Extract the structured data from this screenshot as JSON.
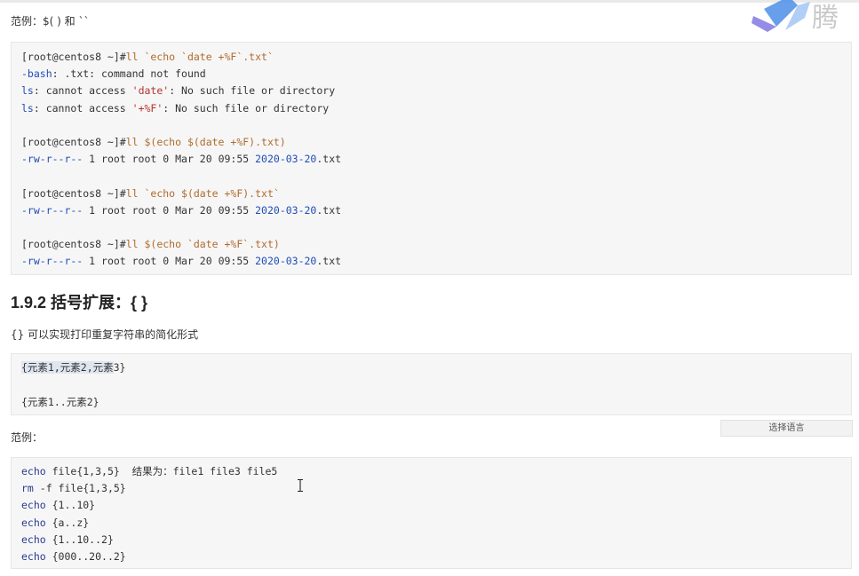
{
  "intro_label": "范例：$( ) 和 ``",
  "code_block_1": {
    "groups": [
      [
        [
          {
            "t": "[root@centos8 ~]#",
            "c": "prompt"
          },
          {
            "t": "ll `echo `date +%F`.txt`",
            "c": "cmd"
          }
        ],
        [
          {
            "t": "-bash",
            "c": "blue"
          },
          {
            "t": ": .txt: command not found",
            "c": ""
          }
        ],
        [
          {
            "t": "ls",
            "c": "blue"
          },
          {
            "t": ": cannot access ",
            "c": ""
          },
          {
            "t": "'date'",
            "c": "red"
          },
          {
            "t": ": No such file or directory",
            "c": ""
          }
        ],
        [
          {
            "t": "ls",
            "c": "blue"
          },
          {
            "t": ": cannot access ",
            "c": ""
          },
          {
            "t": "'+%F'",
            "c": "red"
          },
          {
            "t": ": No such file or directory",
            "c": ""
          }
        ]
      ],
      [
        [
          {
            "t": "[root@centos8 ~]#",
            "c": "prompt"
          },
          {
            "t": "ll $(echo $(date +%F).txt)",
            "c": "cmd"
          }
        ],
        [
          {
            "t": "-rw-r--r--",
            "c": "blue"
          },
          {
            "t": " 1 root root 0 Mar 20 09:55 ",
            "c": ""
          },
          {
            "t": "2020-03-20",
            "c": "blue"
          },
          {
            "t": ".txt",
            "c": ""
          }
        ]
      ],
      [
        [
          {
            "t": "[root@centos8 ~]#",
            "c": "prompt"
          },
          {
            "t": "ll `echo $(date +%F).txt`",
            "c": "cmd"
          }
        ],
        [
          {
            "t": "-rw-r--r--",
            "c": "blue"
          },
          {
            "t": " 1 root root 0 Mar 20 09:55 ",
            "c": ""
          },
          {
            "t": "2020-03-20",
            "c": "blue"
          },
          {
            "t": ".txt",
            "c": ""
          }
        ]
      ],
      [
        [
          {
            "t": "[root@centos8 ~]#",
            "c": "prompt"
          },
          {
            "t": "ll $(echo `date +%F`.txt)",
            "c": "cmd"
          }
        ],
        [
          {
            "t": "-rw-r--r--",
            "c": "blue"
          },
          {
            "t": " 1 root root 0 Mar 20 09:55 ",
            "c": ""
          },
          {
            "t": "2020-03-20",
            "c": "blue"
          },
          {
            "t": ".txt",
            "c": ""
          }
        ]
      ]
    ]
  },
  "section_heading": "1.9.2 括号扩展：{ }",
  "section_desc": "{} 可以实现打印重复字符串的简化形式",
  "syntax_block": {
    "line1_hl": "{元素1,元素2,元素",
    "line1_rest": "3}",
    "line2": "{元素1..元素2}"
  },
  "example_label": "范例：",
  "select_language": "选择语言",
  "code_block_2": {
    "lines": [
      [
        {
          "t": "echo",
          "c": "kw"
        },
        {
          "t": " file{1,3,5}  结果为：file1 file3 file5",
          "c": ""
        }
      ],
      [
        {
          "t": "rm",
          "c": "kw"
        },
        {
          "t": " -f file{1,3,5}",
          "c": ""
        }
      ],
      [
        {
          "t": "echo",
          "c": "kw"
        },
        {
          "t": " {1..10}",
          "c": ""
        }
      ],
      [
        {
          "t": "echo",
          "c": "kw"
        },
        {
          "t": " {a..z}",
          "c": ""
        }
      ],
      [
        {
          "t": "echo",
          "c": "kw"
        },
        {
          "t": " {1..10..2}",
          "c": ""
        }
      ],
      [
        {
          "t": "echo",
          "c": "kw"
        },
        {
          "t": " {000..20..2}",
          "c": ""
        }
      ]
    ]
  },
  "logo_text": "腾",
  "colors": {
    "prompt": "#333333",
    "cmd": "#b06b2d",
    "blue": "#1f4db8",
    "red": "#b4342c",
    "kw": "#2a3b8f"
  }
}
